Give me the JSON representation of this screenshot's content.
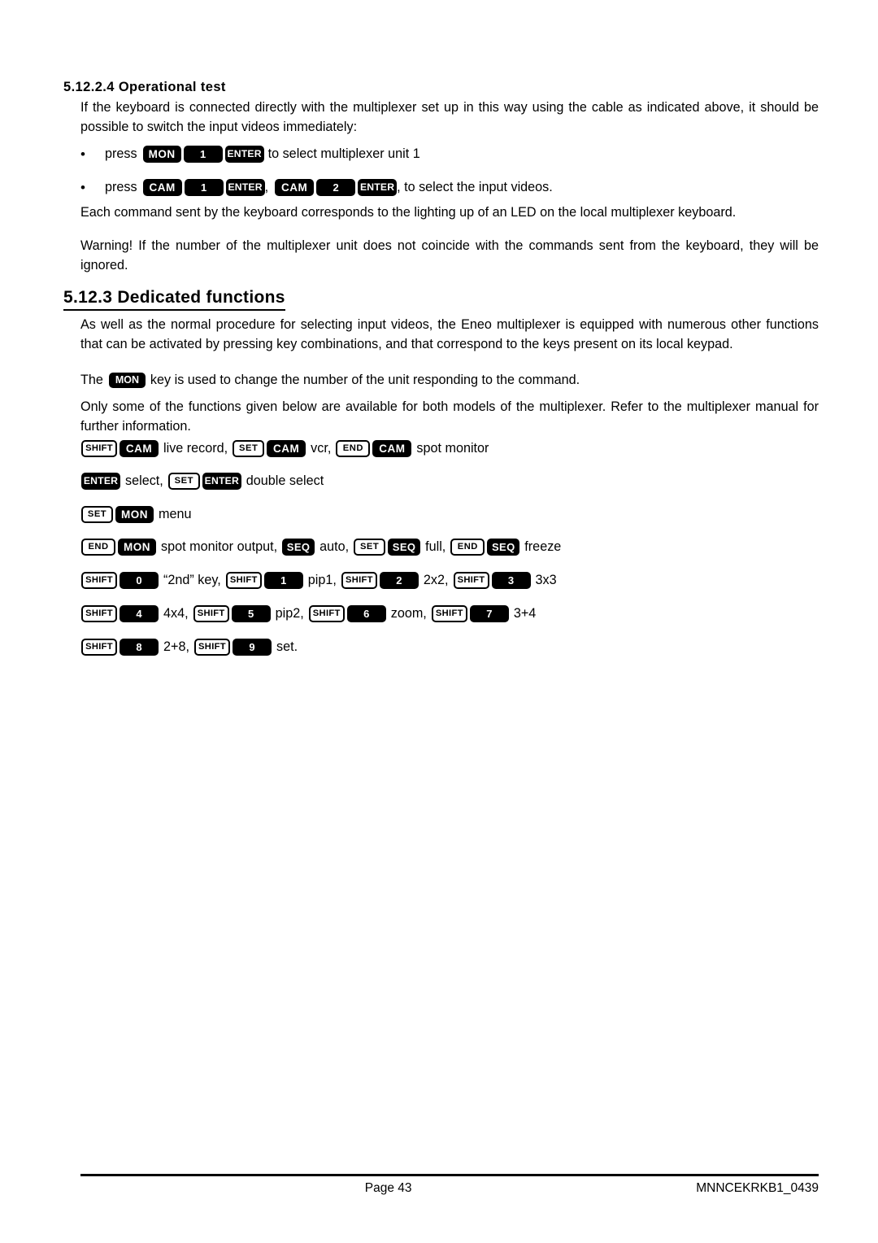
{
  "document": {
    "heading_sub": "5.12.2.4 Operational test",
    "heading_section": "5.12.3 Dedicated functions",
    "intro_paragraph": "If the keyboard is connected directly with the multiplexer set up in this way using the cable as indicated above, it should be possible to switch the input videos immediately:",
    "led_paragraph": "Each command sent by the keyboard corresponds to the lighting up of an LED on the local multiplexer keyboard.",
    "warning_paragraph": "Warning! If the number of the multiplexer unit does not coincide with the commands sent from the keyboard, they will be ignored.",
    "dedicated_paragraph": "As well as the normal procedure for selecting input videos, the Eneo multiplexer is equipped with numerous other functions that can be activated by pressing key combinations, and that correspond to the keys present on its local keypad.",
    "mon_sentence_pre": "The",
    "mon_sentence_post": "key is used to change the number of the unit responding to the command.",
    "availability_paragraph": "Only some of the functions given below are available for both models of the multiplexer. Refer to the multiplexer manual for further information."
  },
  "bullets": [
    {
      "marker": "•",
      "label": "press",
      "keys": [
        "MON",
        "1",
        "ENTER"
      ],
      "trailing": "to select multiplexer unit 1"
    },
    {
      "marker": "•",
      "label": "press",
      "keys_group_1": [
        "CAM",
        "1",
        "ENTER"
      ],
      "separator": ",",
      "keys_group_2": [
        "CAM",
        "2",
        "ENTER"
      ],
      "trailing": ", to select the input videos."
    }
  ],
  "keys": {
    "mon": "MON",
    "cam": "CAM",
    "enter": "ENTER",
    "shift": "SHIFT",
    "set": "SET",
    "end": "END",
    "seq": "SEQ",
    "n0": "0",
    "n1": "1",
    "n2": "2",
    "n3": "3",
    "n4": "4",
    "n5": "5",
    "n6": "6",
    "n7": "7",
    "n8": "8",
    "n9": "9"
  },
  "functions": [
    {
      "row": 1,
      "items": [
        {
          "combo": [
            "SHIFT",
            "CAM"
          ],
          "label": "live record,"
        },
        {
          "combo": [
            "SET",
            "CAM"
          ],
          "label": "vcr,"
        },
        {
          "combo": [
            "END",
            "CAM"
          ],
          "label": "spot monitor"
        }
      ]
    },
    {
      "row": 2,
      "items": [
        {
          "combo": [
            "ENTER"
          ],
          "label": "select,"
        },
        {
          "combo": [
            "SET",
            "ENTER"
          ],
          "label": "double select"
        }
      ]
    },
    {
      "row": 3,
      "items": [
        {
          "combo": [
            "SET",
            "MON"
          ],
          "label": "menu"
        }
      ]
    },
    {
      "row": 4,
      "items": [
        {
          "combo": [
            "END",
            "MON"
          ],
          "label": "spot monitor output,"
        },
        {
          "combo": [
            "SEQ"
          ],
          "label": "auto,"
        },
        {
          "combo": [
            "SET",
            "SEQ"
          ],
          "label": "full,"
        },
        {
          "combo": [
            "END",
            "SEQ"
          ],
          "label": "freeze"
        }
      ]
    },
    {
      "row": 5,
      "items": [
        {
          "combo": [
            "SHIFT",
            "0"
          ],
          "label": "“2nd” key,"
        },
        {
          "combo": [
            "SHIFT",
            "1"
          ],
          "label": "pip1,"
        },
        {
          "combo": [
            "SHIFT",
            "2"
          ],
          "label": "2x2,"
        },
        {
          "combo": [
            "SHIFT",
            "3"
          ],
          "label": "3x3"
        }
      ]
    },
    {
      "row": 6,
      "items": [
        {
          "combo": [
            "SHIFT",
            "4"
          ],
          "label": "4x4,"
        },
        {
          "combo": [
            "SHIFT",
            "5"
          ],
          "label": "pip2,"
        },
        {
          "combo": [
            "SHIFT",
            "6"
          ],
          "label": "zoom,"
        },
        {
          "combo": [
            "SHIFT",
            "7"
          ],
          "label": "3+4"
        }
      ]
    },
    {
      "row": 7,
      "items": [
        {
          "combo": [
            "SHIFT",
            "8"
          ],
          "label": "2+8,"
        },
        {
          "combo": [
            "SHIFT",
            "9"
          ],
          "label": "set."
        }
      ]
    }
  ],
  "function_labels": {
    "live_record": "live record,",
    "vcr": "vcr,",
    "spot_monitor": "spot monitor",
    "select": "select,",
    "double_select": "double select",
    "menu": "menu",
    "spot_monitor_output": "spot monitor output,",
    "auto": "auto,",
    "full": "full,",
    "freeze": "freeze",
    "second_key": "“2nd” key,",
    "pip1": "pip1,",
    "two_by_two": "2x2,",
    "three_by_three": "3x3",
    "four_by_four": "4x4,",
    "pip2": "pip2,",
    "zoom": "zoom,",
    "three_plus_four": "3+4",
    "two_plus_eight": "2+8,",
    "set_label": "set."
  },
  "footer": {
    "page_label": "Page 43",
    "doc_code": "MNNCEKRKB1_0439"
  },
  "colors": {
    "page_background": "#ffffff",
    "text": "#000000",
    "key_dark_fill": "#000000",
    "key_dark_text": "#ffffff",
    "key_light_fill": "#ffffff",
    "key_light_border": "#000000"
  }
}
